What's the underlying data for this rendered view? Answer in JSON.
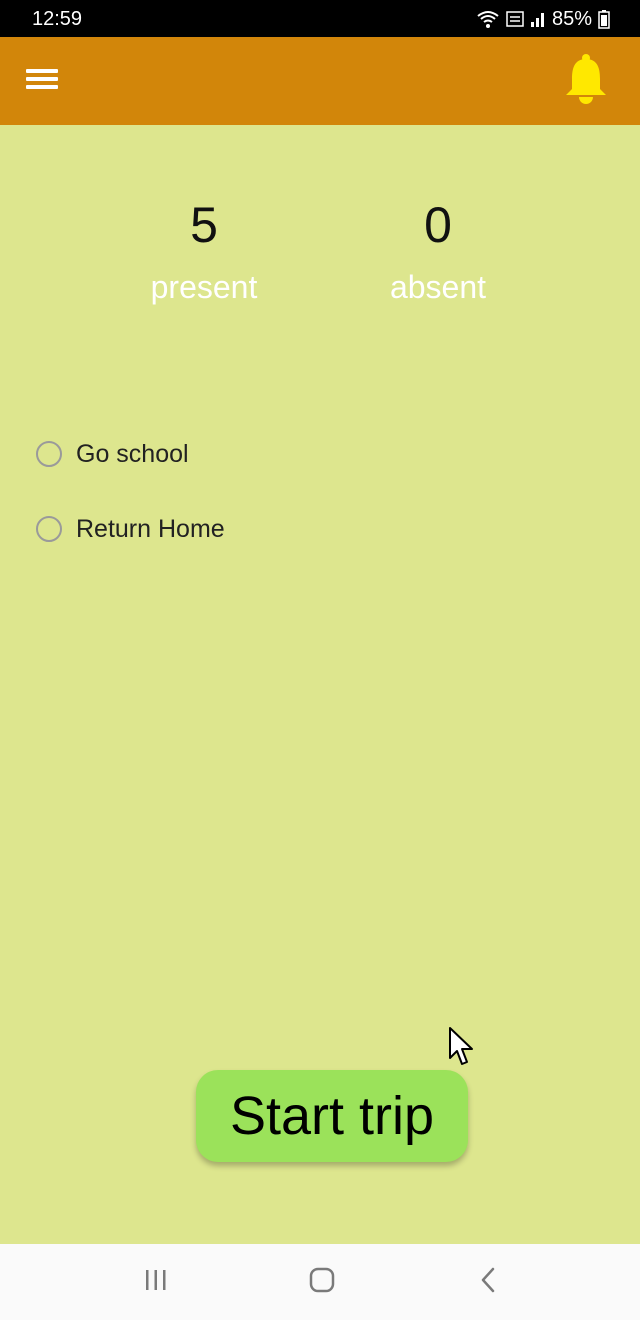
{
  "status_bar": {
    "time": "12:59",
    "battery": "85%",
    "icons": [
      "wifi-icon",
      "volte-icon",
      "signal-icon",
      "battery-icon"
    ]
  },
  "app_bar": {
    "menu_icon": "hamburger-menu-icon",
    "notification_icon": "bell-icon",
    "background_color": "#d2860a",
    "bell_color": "#ffe800"
  },
  "stats": {
    "present": {
      "value": "5",
      "label": "present"
    },
    "absent": {
      "value": "0",
      "label": "absent"
    }
  },
  "trip_options": [
    {
      "label": "Go school",
      "selected": false
    },
    {
      "label": "Return Home",
      "selected": false
    }
  ],
  "start_button": {
    "label": "Start trip",
    "color": "#9be25a"
  },
  "nav_bar": {
    "icons": [
      "recents-icon",
      "home-icon",
      "back-icon"
    ]
  },
  "theme": {
    "background": "#dde68e"
  }
}
